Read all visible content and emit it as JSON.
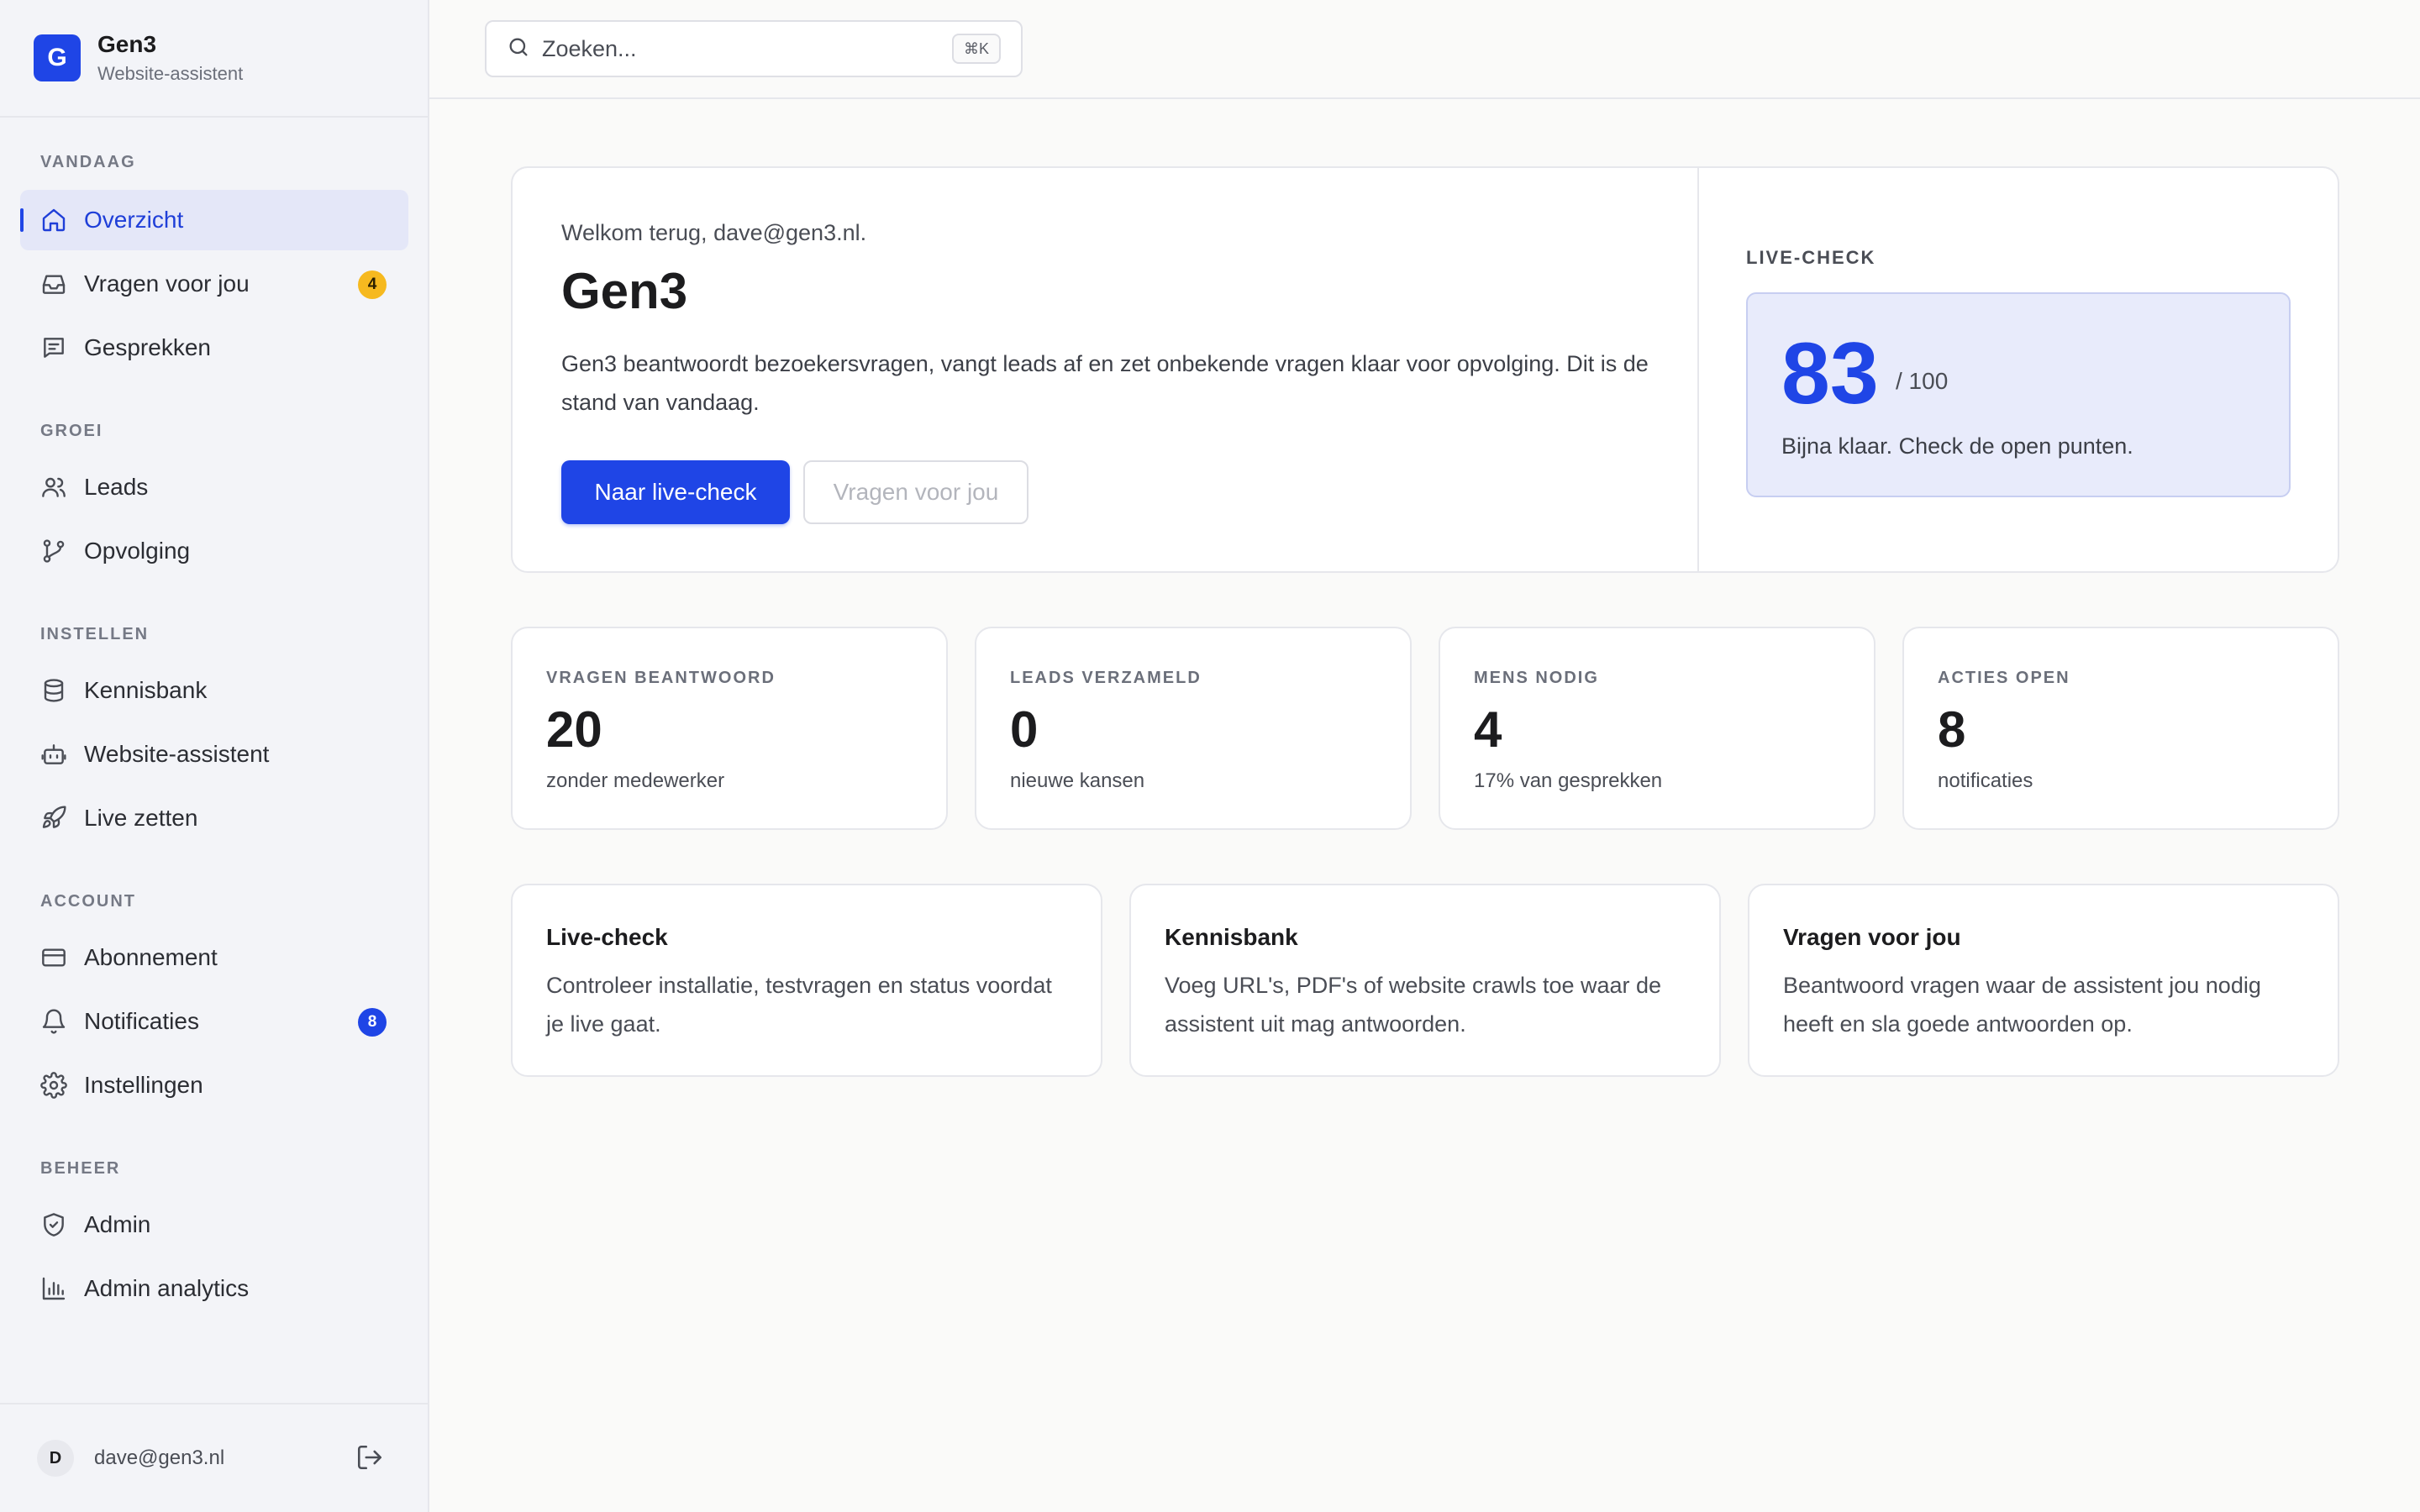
{
  "brand": {
    "logo_letter": "G",
    "name": "Gen3",
    "subtitle": "Website-assistent"
  },
  "sidebar": {
    "sections": [
      {
        "label": "VANDAAG"
      },
      {
        "label": "GROEI"
      },
      {
        "label": "INSTELLEN"
      },
      {
        "label": "ACCOUNT"
      },
      {
        "label": "BEHEER"
      }
    ],
    "items": [
      {
        "label": "Overzicht",
        "icon": "home-icon",
        "active": true
      },
      {
        "label": "Vragen voor jou",
        "icon": "inbox-icon",
        "badge": "4"
      },
      {
        "label": "Gesprekken",
        "icon": "message-icon"
      },
      {
        "label": "Leads",
        "icon": "users-icon"
      },
      {
        "label": "Opvolging",
        "icon": "git-branch-icon"
      },
      {
        "label": "Kennisbank",
        "icon": "database-icon"
      },
      {
        "label": "Website-assistent",
        "icon": "bot-icon"
      },
      {
        "label": "Live zetten",
        "icon": "rocket-icon"
      },
      {
        "label": "Abonnement",
        "icon": "credit-card-icon"
      },
      {
        "label": "Notificaties",
        "icon": "bell-icon",
        "badge": "8"
      },
      {
        "label": "Instellingen",
        "icon": "gear-icon"
      },
      {
        "label": "Admin",
        "icon": "shield-icon"
      },
      {
        "label": "Admin analytics",
        "icon": "bar-chart-icon"
      }
    ]
  },
  "user": {
    "avatar_letter": "D",
    "email": "dave@gen3.nl"
  },
  "search": {
    "placeholder": "Zoeken...",
    "shortcut": "⌘K"
  },
  "hero": {
    "welcome": "Welkom terug, dave@gen3.nl.",
    "title": "Gen3",
    "description": "Gen3 beantwoordt bezoekersvragen, vangt leads af en zet onbekende vragen klaar voor opvolging. Dit is de stand van vandaag.",
    "primary_button": "Naar live-check",
    "secondary_button": "Vragen voor jou"
  },
  "live_check": {
    "label": "LIVE-CHECK",
    "score": "83",
    "max": "/ 100",
    "message": "Bijna klaar. Check de open punten."
  },
  "stats": [
    {
      "label": "VRAGEN BEANTWOORD",
      "value": "20",
      "sub": "zonder medewerker"
    },
    {
      "label": "LEADS VERZAMELD",
      "value": "0",
      "sub": "nieuwe kansen"
    },
    {
      "label": "MENS NODIG",
      "value": "4",
      "sub": "17% van gesprekken"
    },
    {
      "label": "ACTIES OPEN",
      "value": "8",
      "sub": "notificaties"
    }
  ],
  "cards": [
    {
      "title": "Live-check",
      "description": "Controleer installatie, testvragen en status voordat je live gaat."
    },
    {
      "title": "Kennisbank",
      "description": "Voeg URL's, PDF's of website crawls toe waar de assistent uit mag antwoorden."
    },
    {
      "title": "Vragen voor jou",
      "description": "Beantwoord vragen waar de assistent jou nodig heeft en sla goede antwoorden op."
    }
  ],
  "colors": {
    "accent": "#1f45e6",
    "badge_yellow": "#f6b91f",
    "score_bg": "#e8ebfb"
  }
}
